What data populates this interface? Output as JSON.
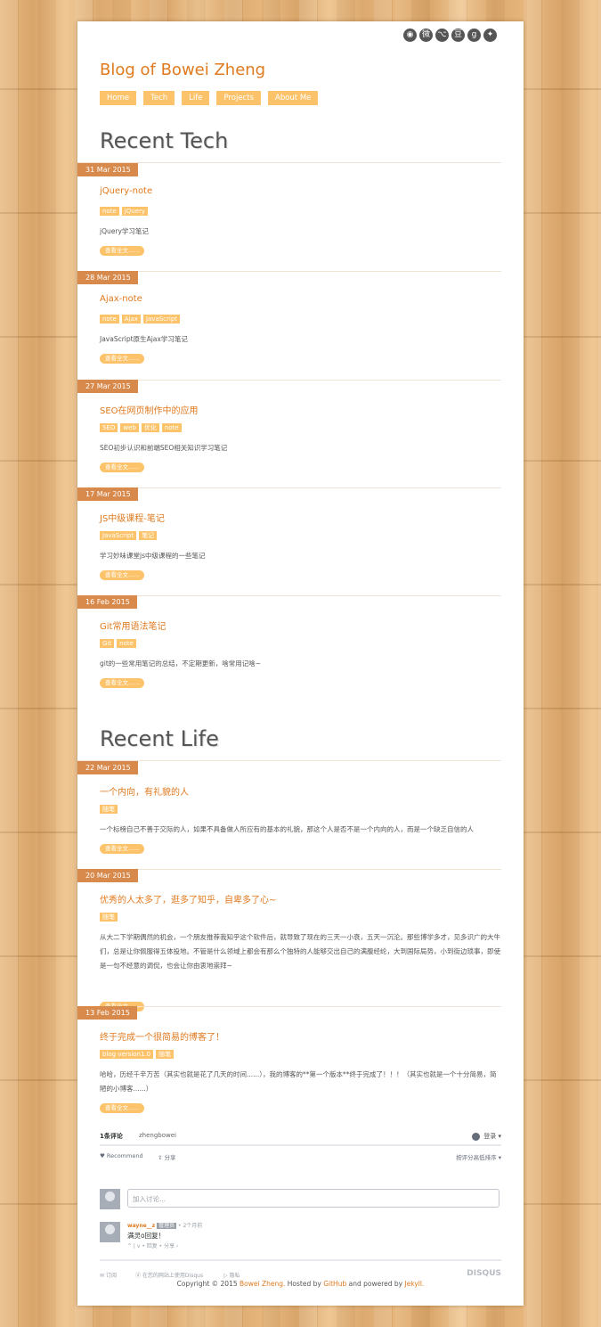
{
  "site": {
    "title": "Blog of Bowei Zheng"
  },
  "social_icons": [
    "rss-icon",
    "weibo-icon",
    "github-icon",
    "douban-icon",
    "google-plus-icon",
    "twitter-icon"
  ],
  "nav": [
    "Home",
    "Tech",
    "Life",
    "Projects",
    "About Me"
  ],
  "tech": {
    "title": "Recent Tech",
    "posts": [
      {
        "date": "31 Mar 2015",
        "title": "jQuery-note",
        "tags": [
          "note",
          "jQuery"
        ],
        "excerpt": "jQuery学习笔记",
        "more": "查看全文......"
      },
      {
        "date": "28 Mar 2015",
        "title": "Ajax-note",
        "tags": [
          "note",
          "Ajax",
          "JavaScript"
        ],
        "excerpt": "JavaScript原生Ajax学习笔记",
        "more": "查看全文......"
      },
      {
        "date": "27 Mar 2015",
        "title": "SEO在网页制作中的应用",
        "tags": [
          "SEO",
          "web",
          "优化",
          "note"
        ],
        "excerpt": "SEO初步认识和前端SEO相关知识学习笔记",
        "more": "查看全文......"
      },
      {
        "date": "17 Mar 2015",
        "title": "JS中级课程-笔记",
        "tags": [
          "JavaScript",
          "笔记"
        ],
        "excerpt": "学习妙味课堂js中级课程的一些笔记",
        "more": "查看全文......"
      },
      {
        "date": "16 Feb 2015",
        "title": "Git常用语法笔记",
        "tags": [
          "Git",
          "note"
        ],
        "excerpt": "git的一些常用笔记的总结，不定期更新，啥常用记啥~",
        "more": "查看全文......"
      }
    ]
  },
  "life": {
    "title": "Recent Life",
    "posts": [
      {
        "date": "22 Mar 2015",
        "title": "一个内向，有礼貌的人",
        "tags": [
          "随笔"
        ],
        "excerpt": "一个标榜自己不善于交际的人，如果不具备做人所应有的基本的礼貌，那这个人是否不是一个内向的人，而是一个缺乏自信的人",
        "more": "查看全文......"
      },
      {
        "date": "20 Mar 2015",
        "title": "优秀的人太多了，逛多了知乎，自卑多了心~",
        "tags": [
          "随笔"
        ],
        "excerpt": "从大二下学期偶然的机会，一个朋友推荐我知乎这个软件后，就导致了现在的三天一小衰，五天一沉沦。那些博学多才，见多识广的大牛们，总是让你佩服得五体投地。不管是什么领域上都会有那么个独特的人能够交出自己的满腹经纶，大到国际局势，小到街边琐事，即使是一句不经意的调侃，也会让你由衷地崇拜~",
        "more": "查看全文......"
      },
      {
        "date": "13 Feb 2015",
        "title": "终于完成一个很简易的博客了！",
        "tags": [
          "blog version1.0",
          "随笔"
        ],
        "excerpt": "哈哈，历经千辛万苦（其实也就是花了几天的时间......），我的博客的**第一个版本**终于完成了！！！（其实也就是一个十分简易，简陋的小博客......）",
        "more": "查看全文......"
      }
    ]
  },
  "disqus": {
    "tab_comments": "1条评论",
    "tab_site": "zhengbowei",
    "login": "登录",
    "recommend": "Recommend",
    "share": "分享",
    "sort": "按评分高低排序",
    "placeholder": "加入讨论...",
    "comment": {
      "author": "wayne__z",
      "badge": "管理员",
      "time": "• 2个月前",
      "text": "满灵o回复！",
      "actions": "^ | v • 回复 • 分享 ›"
    },
    "subscribe": "订阅",
    "add_disqus": "在您的网站上使用Disqus",
    "privacy": "隐私",
    "brand": "DISQUS"
  },
  "footer": {
    "prefix": "Copyright © 2015",
    "author": "Bowei Zheng.",
    "hosted": "Hosted by",
    "github": "GitHub",
    "powered": "and powered by",
    "jekyll": "Jekyll."
  }
}
